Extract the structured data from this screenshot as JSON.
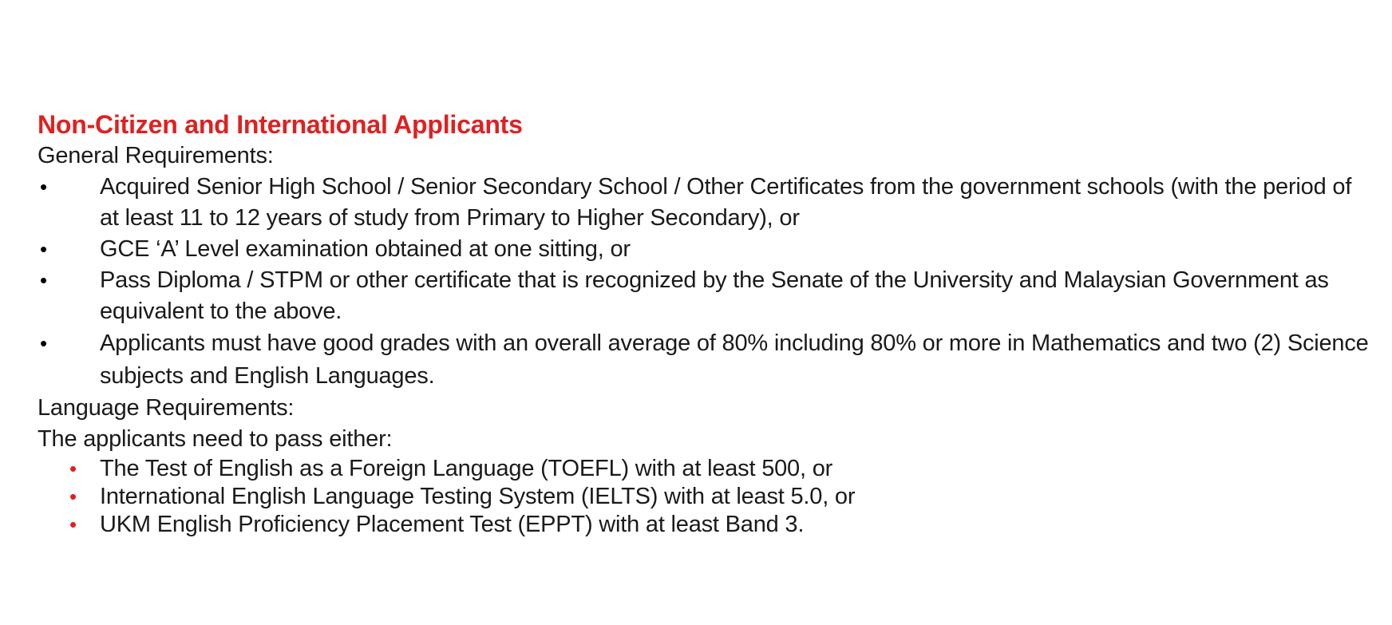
{
  "section": {
    "title": "Non-Citizen and International Applicants",
    "general_heading": "General Requirements:",
    "general_items": [
      "Acquired Senior High School / Senior Secondary School / Other Certificates from the government schools (with the period of at least 11 to 12 years of study from Primary to Higher Secondary), or",
      "GCE ‘A’ Level examination obtained at one sitting, or",
      "Pass Diploma / STPM or other certificate that is recognized by the Senate of the University and Malaysian Government as equivalent to the above.",
      "Applicants must have good grades with an overall average of 80% including 80% or more in Mathematics and two (2) Science subjects and English Languages."
    ],
    "language_heading": "Language Requirements:",
    "language_intro": "The applicants need to pass either:",
    "language_items": [
      "The Test of English as a Foreign Language (TOEFL) with at least 500, or",
      "International English Language Testing System (IELTS) with at least 5.0, or",
      "UKM English Proficiency Placement Test (EPPT) with at least Band 3."
    ]
  },
  "bullets": {
    "general": "•",
    "language": "•"
  },
  "colors": {
    "title": "#e02020",
    "text": "#1a1a1a",
    "language_bullet": "#e02020"
  }
}
